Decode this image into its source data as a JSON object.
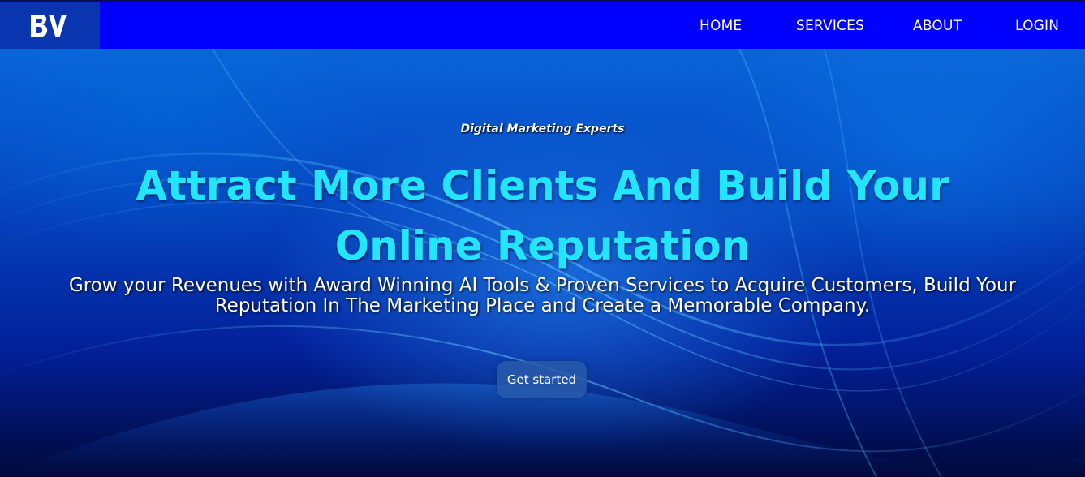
{
  "header": {
    "logo_text": "BV",
    "nav": [
      {
        "label": "HOME"
      },
      {
        "label": "SERVICES"
      },
      {
        "label": "ABOUT"
      },
      {
        "label": "LOGIN"
      }
    ]
  },
  "hero": {
    "eyebrow": "Digital Marketing Experts",
    "headline": "Attract More Clients And Build Your Online Reputation",
    "subtext": "Grow your Revenues with Award Winning AI Tools & Proven Services to Acquire Customers, Build Your Reputation In The Marketing Place and Create a Memorable Company.",
    "cta_label": "Get started"
  },
  "colors": {
    "navbar": "#0000fe",
    "logo_box": "#0a35b0",
    "headline": "#22e6ff",
    "nav_text": "#ffffff"
  }
}
